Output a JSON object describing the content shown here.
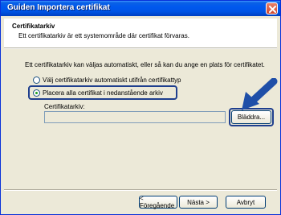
{
  "window": {
    "title": "Guiden Importera certifikat"
  },
  "header": {
    "title": "Certifikatarkiv",
    "subtitle": "Ett certifikatarkiv är ett systemområde där certifikat förvaras."
  },
  "body": {
    "description": "Ett certifikatarkiv kan väljas automatiskt, eller så kan du ange en plats för certifikatet.",
    "options": [
      {
        "label": "Välj certifikatarkiv automatiskt utifrån certifikattyp",
        "selected": false
      },
      {
        "label": "Placera alla certifikat i nedanstående arkiv",
        "selected": true
      }
    ],
    "store_label": "Certifikatarkiv:",
    "store_value": "",
    "browse_label": "Bläddra..."
  },
  "footer": {
    "back_label": "< Föregående",
    "next_label": "Nästa >",
    "cancel_label": "Avbryt"
  },
  "colors": {
    "titlebar": "#0055e5",
    "highlight": "#1f3f8e",
    "arrow": "#1f4fa8"
  }
}
